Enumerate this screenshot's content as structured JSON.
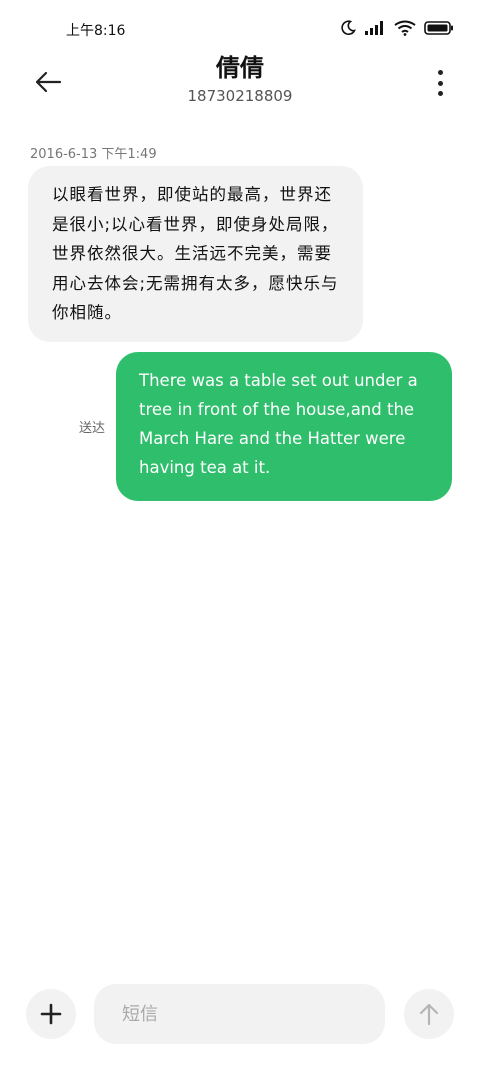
{
  "status_bar": {
    "time": "上午8:16",
    "icons": [
      "moon-icon",
      "signal-icon",
      "wifi-icon",
      "battery-icon"
    ]
  },
  "header": {
    "contact_name": "倩倩",
    "phone_number": "18730218809",
    "icons": [
      "back-arrow-icon",
      "more-vertical-icon"
    ]
  },
  "conversation": {
    "timestamp": "2016-6-13  下午1:49",
    "messages": [
      {
        "direction": "incoming",
        "text": "以眼看世界，即使站的最高，世界还是很小;以心看世界，即使身处局限，世界依然很大。生活远不完美，需要用心去体会;无需拥有太多，愿快乐与你相随。"
      },
      {
        "direction": "outgoing",
        "status": "送达",
        "text": "There was a table set out under a tree in front of the house,and the March Hare and the Hatter were having tea at it."
      }
    ]
  },
  "composer": {
    "placeholder": "短信",
    "icons": [
      "plus-icon",
      "send-arrow-up-icon"
    ]
  },
  "colors": {
    "outgoing_bubble": "#2fbf6c",
    "incoming_bubble": "#f2f2f2",
    "background": "#ffffff"
  }
}
